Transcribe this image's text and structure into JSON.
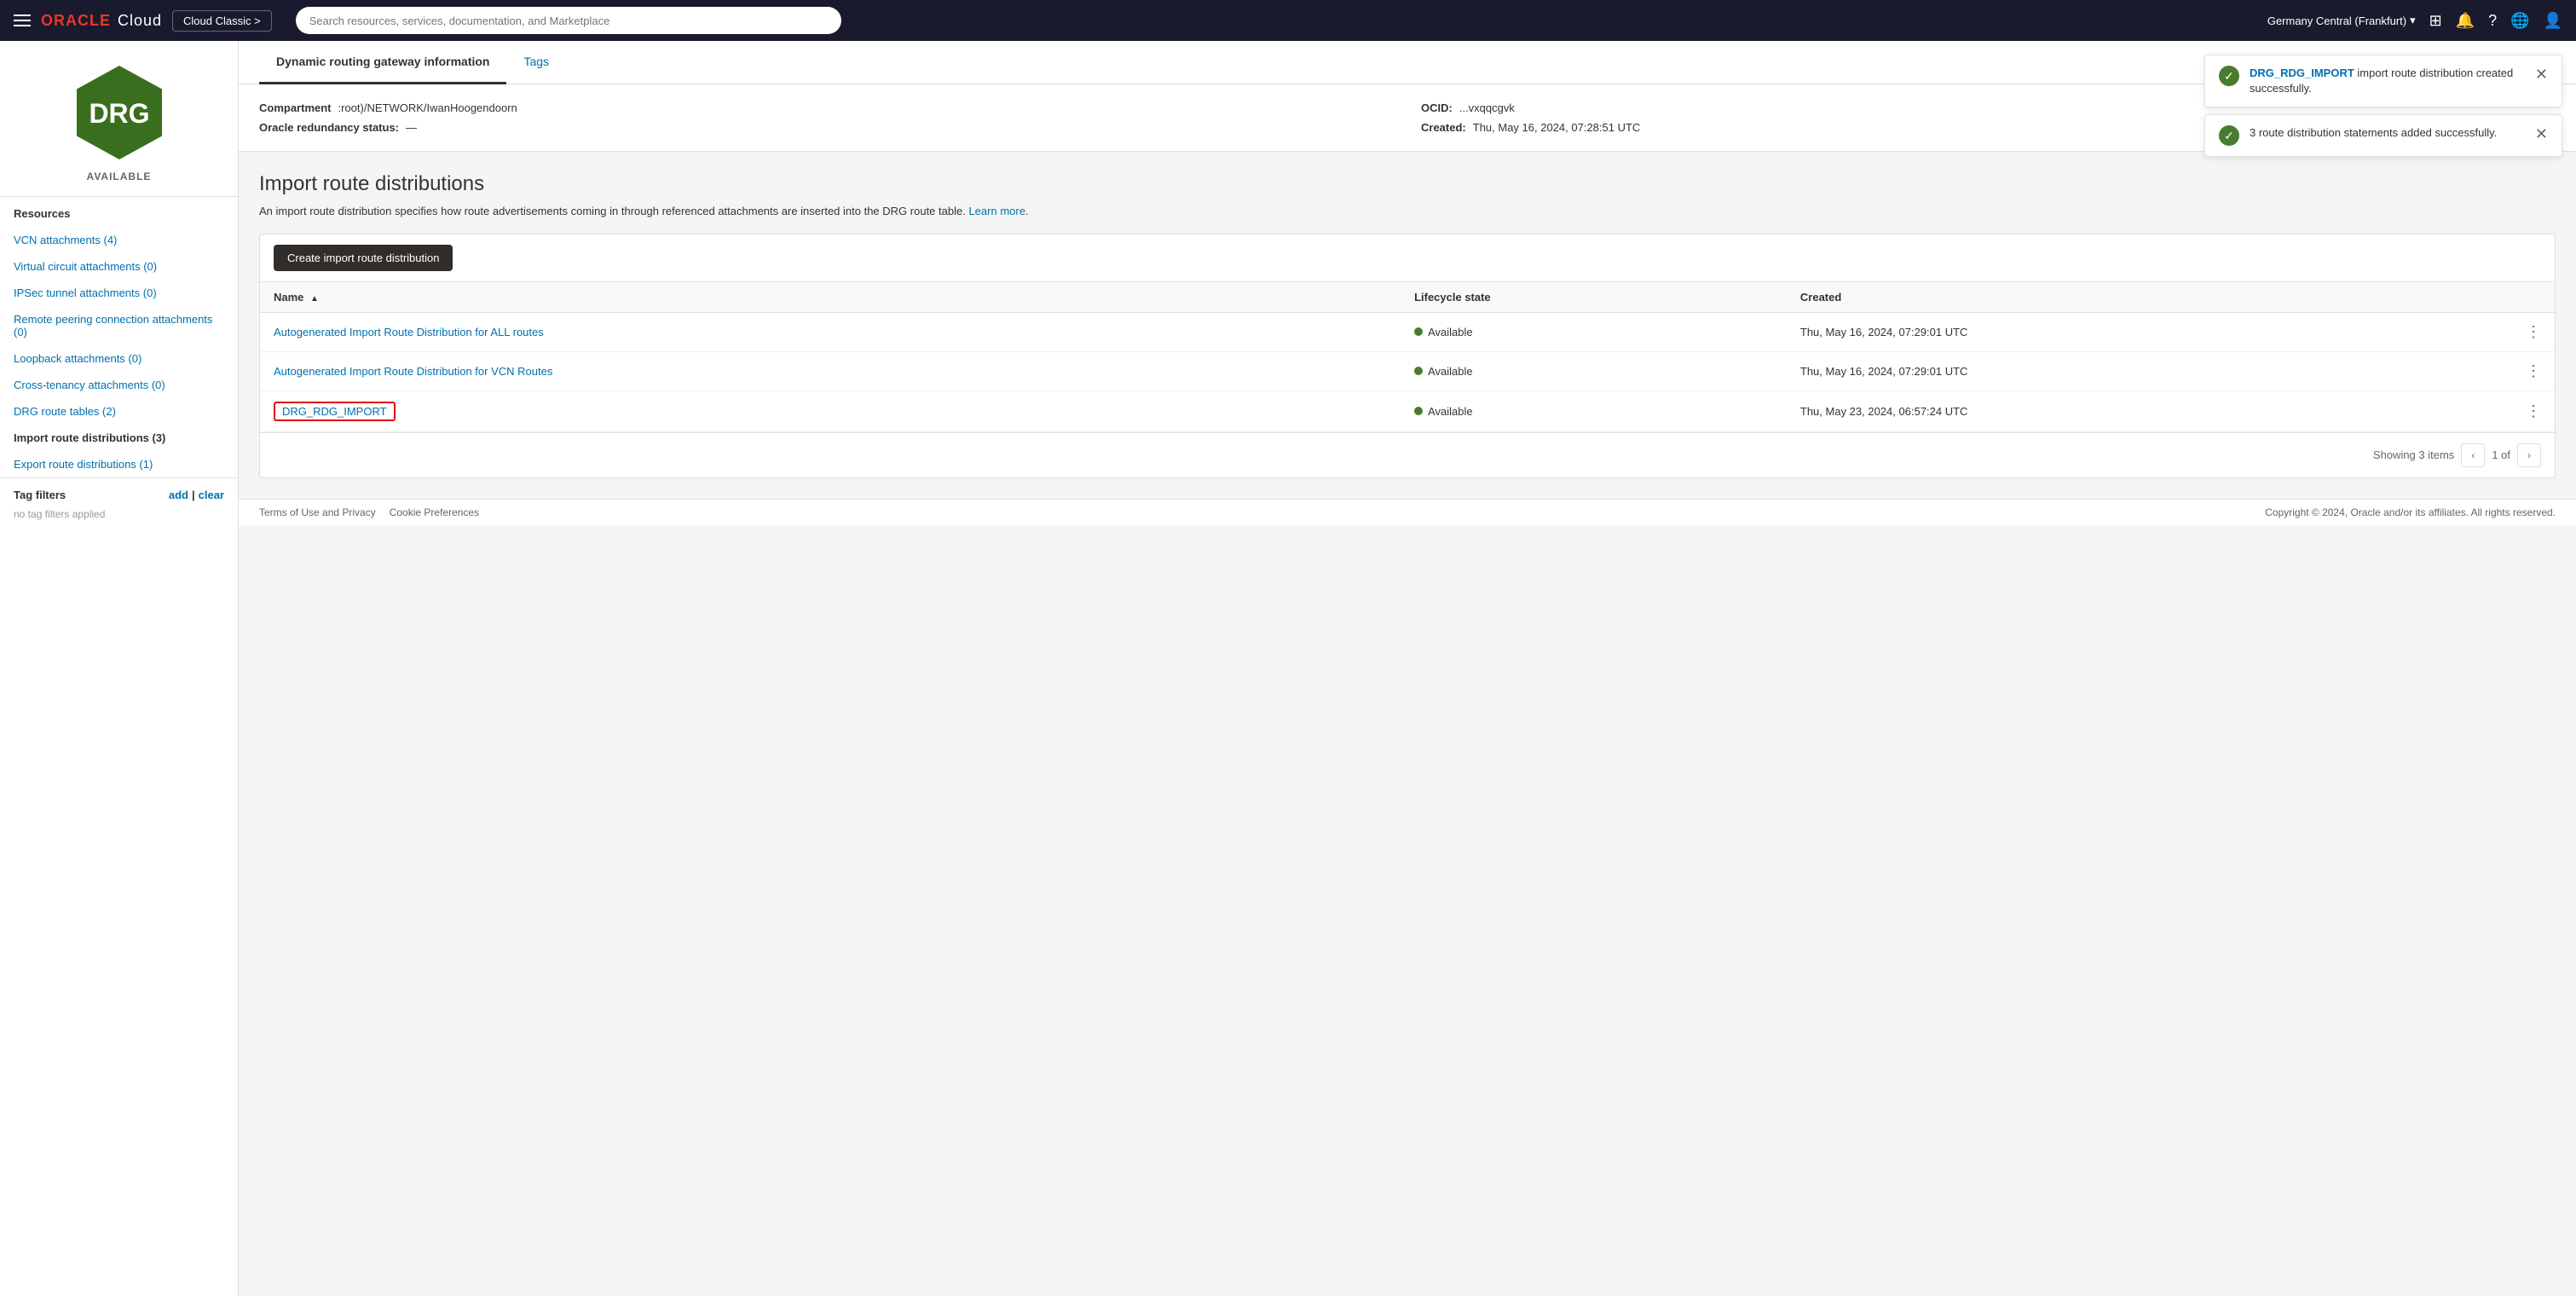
{
  "navbar": {
    "brand": "ORACLE Cloud",
    "oracle_text": "ORACLE",
    "cloud_text": "Cloud",
    "classic_btn": "Cloud Classic >",
    "search_placeholder": "Search resources, services, documentation, and Marketplace",
    "region": "Germany Central (Frankfurt)",
    "region_chevron": "▾"
  },
  "sidebar": {
    "drg_label": "AVAILABLE",
    "resources_title": "Resources",
    "items": [
      {
        "label": "VCN attachments (4)",
        "active": false
      },
      {
        "label": "Virtual circuit attachments (0)",
        "active": false
      },
      {
        "label": "IPSec tunnel attachments (0)",
        "active": false
      },
      {
        "label": "Remote peering connection attachments (0)",
        "active": false
      },
      {
        "label": "Loopback attachments (0)",
        "active": false
      },
      {
        "label": "Cross-tenancy attachments (0)",
        "active": false
      },
      {
        "label": "DRG route tables (2)",
        "active": false
      },
      {
        "label": "Import route distributions (3)",
        "active": true
      },
      {
        "label": "Export route distributions (1)",
        "active": false
      }
    ],
    "tag_filters_title": "Tag filters",
    "tag_add": "add",
    "tag_clear": "clear",
    "tag_divider": "|",
    "no_filters": "no tag filters applied"
  },
  "tabs": [
    {
      "label": "Dynamic routing gateway information",
      "active": true
    },
    {
      "label": "Tags",
      "active": false
    }
  ],
  "drg_info": {
    "compartment_label": "Compartment",
    "compartment_value": ":root)/NETWORK/IwanHoogendoorn",
    "ocid_label": "OCID:",
    "ocid_value": "...vxqqcgvk",
    "redundancy_label": "Oracle redundancy status:",
    "redundancy_value": "—",
    "created_label": "Created:",
    "created_value": "Thu, May 16, 2024, 07:28:51 UTC"
  },
  "notifications": [
    {
      "id": "notif1",
      "link_text": "DRG_RDG_IMPORT",
      "message": " import route distribution created successfully.",
      "type": "success"
    },
    {
      "id": "notif2",
      "message": "3 route distribution statements added successfully.",
      "type": "success"
    }
  ],
  "import_section": {
    "title": "Import route distributions",
    "description": "An import route distribution specifies how route advertisements coming in through referenced attachments are inserted into the DRG route table.",
    "learn_more": "Learn more",
    "create_btn": "Create import route distribution"
  },
  "table": {
    "columns": [
      {
        "label": "Name",
        "sortable": true,
        "sort_dir": "asc"
      },
      {
        "label": "Lifecycle state",
        "sortable": false
      },
      {
        "label": "Created",
        "sortable": false
      }
    ],
    "rows": [
      {
        "name": "Autogenerated Import Route Distribution for ALL routes",
        "state": "Available",
        "created": "Thu, May 16, 2024, 07:29:01 UTC",
        "highlighted": false
      },
      {
        "name": "Autogenerated Import Route Distribution for VCN Routes",
        "state": "Available",
        "created": "Thu, May 16, 2024, 07:29:01 UTC",
        "highlighted": false
      },
      {
        "name": "DRG_RDG_IMPORT",
        "state": "Available",
        "created": "Thu, May 23, 2024, 06:57:24 UTC",
        "highlighted": true
      }
    ],
    "showing_text": "Showing 3 items",
    "page_text": "1 of"
  },
  "footer": {
    "copyright": "Copyright © 2024, Oracle and/or its affiliates. All rights reserved.",
    "links": [
      {
        "label": "Terms of Use and Privacy"
      },
      {
        "label": "Cookie Preferences"
      }
    ]
  }
}
